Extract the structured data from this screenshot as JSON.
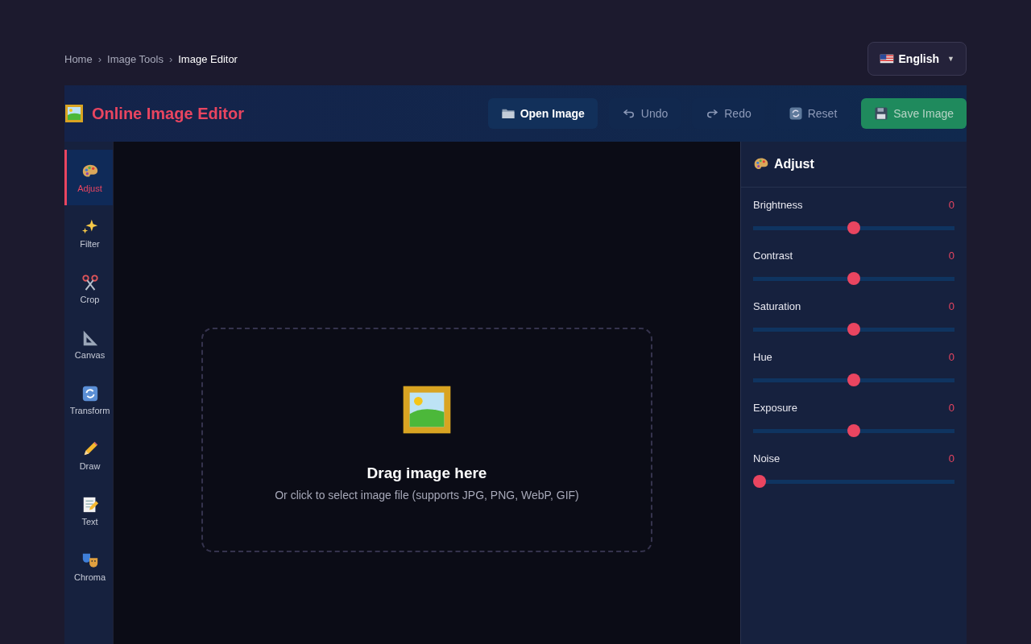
{
  "breadcrumb": {
    "items": [
      {
        "label": "Home",
        "current": false
      },
      {
        "label": "Image Tools",
        "current": false
      },
      {
        "label": "Image Editor",
        "current": true
      }
    ],
    "separator": "›"
  },
  "language": {
    "label": "English",
    "caret": "▼"
  },
  "header": {
    "title": "Online Image Editor"
  },
  "toolbar": [
    {
      "label": "Open Image",
      "kind": "open",
      "disabled": false
    },
    {
      "label": "Undo",
      "kind": "undo",
      "disabled": true
    },
    {
      "label": "Redo",
      "kind": "redo",
      "disabled": true
    },
    {
      "label": "Reset",
      "kind": "reset",
      "disabled": true
    },
    {
      "label": "Save Image",
      "kind": "save",
      "disabled": true
    }
  ],
  "sidebar": {
    "items": [
      {
        "label": "Adjust",
        "selected": true
      },
      {
        "label": "Filter",
        "selected": false
      },
      {
        "label": "Crop",
        "selected": false
      },
      {
        "label": "Canvas",
        "selected": false
      },
      {
        "label": "Transform",
        "selected": false
      },
      {
        "label": "Draw",
        "selected": false
      },
      {
        "label": "Text",
        "selected": false
      },
      {
        "label": "Chroma",
        "selected": false
      }
    ]
  },
  "drop_zone": {
    "title": "Drag image here",
    "hint": "Or click to select image file (supports JPG, PNG, WebP, GIF)"
  },
  "panel": {
    "title": "Adjust",
    "sliders": [
      {
        "name": "Brightness",
        "reading": "0",
        "level": 0.5
      },
      {
        "name": "Contrast",
        "reading": "0",
        "level": 0.5
      },
      {
        "name": "Saturation",
        "reading": "0",
        "level": 0.5
      },
      {
        "name": "Hue",
        "reading": "0",
        "level": 0.5
      },
      {
        "name": "Exposure",
        "reading": "0",
        "level": 0.5
      },
      {
        "name": "Noise",
        "reading": "0",
        "level": 0
      }
    ]
  }
}
